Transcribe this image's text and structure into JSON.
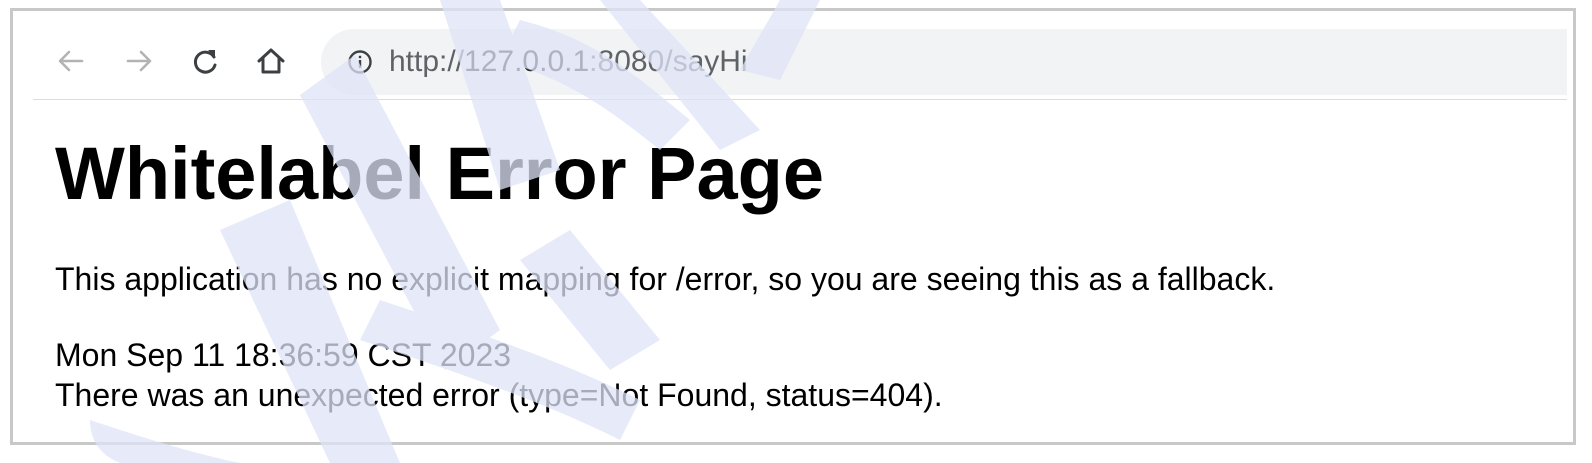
{
  "browser": {
    "back_icon": "arrow-left-icon",
    "forward_icon": "arrow-right-icon",
    "reload_icon": "reload-icon",
    "home_icon": "home-icon",
    "info_icon": "info-icon",
    "url_prefix": "http://",
    "url_host": "127.0.0.1",
    "url_rest": ":8080/sayHi"
  },
  "page": {
    "title": "Whitelabel Error Page",
    "message": "This application has no explicit mapping for /error, so you are seeing this as a fallback.",
    "timestamp": "Mon Sep 11 18:36:59 CST 2023",
    "error_detail": "There was an unexpected error (type=Not Found, status=404)."
  },
  "colors": {
    "frame_border": "#c8c8c8",
    "address_bar_bg": "#f1f3f4",
    "watermark": "#dfe3f7"
  }
}
